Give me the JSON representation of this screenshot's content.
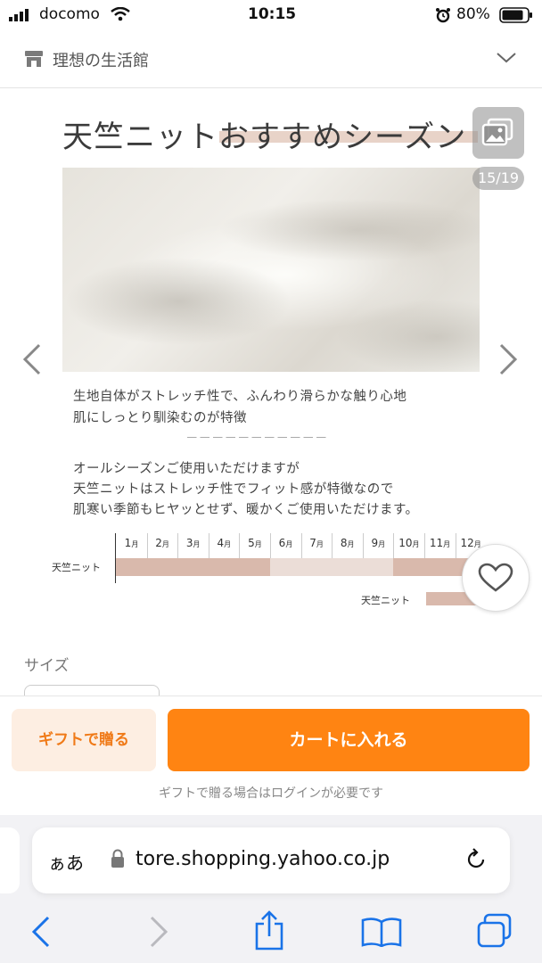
{
  "status_bar": {
    "carrier": "docomo",
    "time": "10:15",
    "battery": "80%"
  },
  "store": {
    "name": "理想の生活館"
  },
  "gallery": {
    "counter": "15/19"
  },
  "hero": {
    "title": "天竺ニットおすすめシーズン",
    "line1": "生地自体がストレッチ性で、ふんわり滑らかな触り心地",
    "line2": "肌にしっとり馴染むのが特徴",
    "dashes": "－－－－－－－－－－－",
    "line3": "オールシーズンご使用いただけますが",
    "line4": "天竺ニットはストレッチ性でフィット感が特徴なので",
    "line5": "肌寒い季節もヒヤッとせず、暖かくご使用いただけます。"
  },
  "season_chart": {
    "row_label": "天竺ニット",
    "legend_label": "天竺ニット",
    "months": [
      {
        "num": "1",
        "unit": "月"
      },
      {
        "num": "2",
        "unit": "月"
      },
      {
        "num": "3",
        "unit": "月"
      },
      {
        "num": "4",
        "unit": "月"
      },
      {
        "num": "5",
        "unit": "月"
      },
      {
        "num": "6",
        "unit": "月"
      },
      {
        "num": "7",
        "unit": "月"
      },
      {
        "num": "8",
        "unit": "月"
      },
      {
        "num": "9",
        "unit": "月"
      },
      {
        "num": "10",
        "unit": "月"
      },
      {
        "num": "11",
        "unit": "月"
      },
      {
        "num": "12",
        "unit": "月"
      }
    ],
    "recommended_color": "#d9b9ac",
    "light_color": "#ebddd7"
  },
  "size": {
    "label": "サイズ"
  },
  "purchase": {
    "gift_button": "ギフトで贈る",
    "cart_button": "カートに入れる",
    "note": "ギフトで贈る場合はログインが必要です",
    "accent": "#ff8412"
  },
  "safari": {
    "aa": "ぁあ",
    "url": "tore.shopping.yahoo.co.jp"
  }
}
